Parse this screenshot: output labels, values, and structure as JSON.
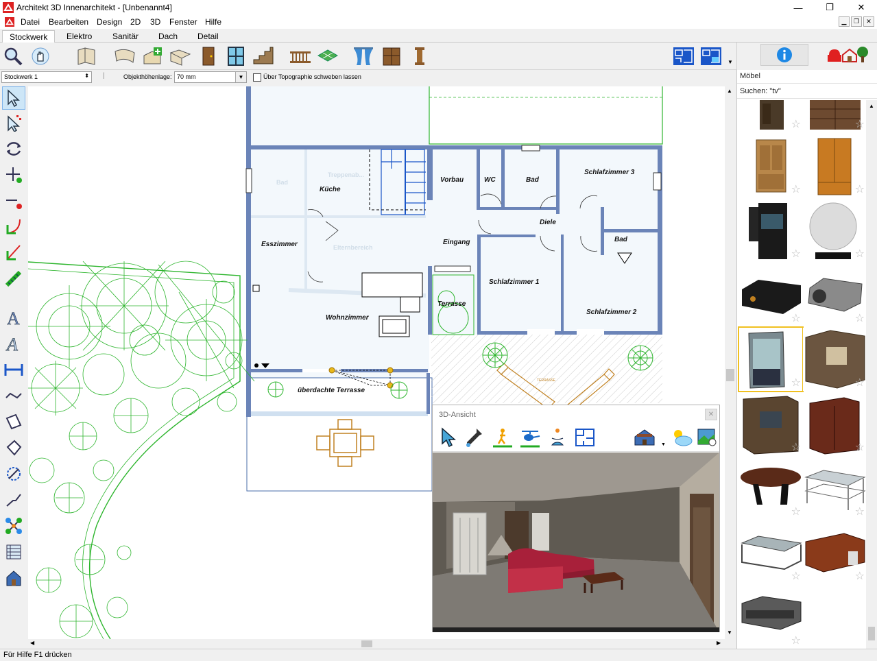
{
  "window": {
    "title": "Architekt 3D Innenarchitekt - [Unbenannt4]",
    "min": "—",
    "max": "❐",
    "close": "✕"
  },
  "menu": [
    "Datei",
    "Bearbeiten",
    "Design",
    "2D",
    "3D",
    "Fenster",
    "Hilfe"
  ],
  "tabs": [
    "Stockwerk",
    "Elektro",
    "Sanitär",
    "Dach",
    "Detail"
  ],
  "props": {
    "floor": "Stockwerk 1",
    "height_label": "Objekthöhenlage:",
    "height_value": "70 mm",
    "float_label": "Über Topographie schweben lassen"
  },
  "catalog": {
    "category": "Möbel",
    "search": "Suchen: \"tv\""
  },
  "rooms": {
    "kueche": "Küche",
    "esszimmer": "Esszimmer",
    "wohnzimmer": "Wohnzimmer",
    "vorbau": "Vorbau",
    "wc": "WC",
    "bad1": "Bad",
    "schlaf3": "Schlafzimmer 3",
    "diele": "Diele",
    "eingang": "Eingang",
    "bad2": "Bad",
    "schlaf1": "Schlafzimmer 1",
    "schlaf2": "Schlafzimmer 2",
    "terrasse": "Terrasse",
    "ueberdacht": "überdachte Terrasse",
    "bad_faint": "Bad",
    "treppe_faint": "Treppenab...",
    "eltern_faint": "Elternbereich",
    "terrasse_small": "TERRASSE"
  },
  "view3d": {
    "title": "3D-Ansicht"
  },
  "status": "Für Hilfe F1 drücken",
  "colors": {
    "wall": "#6b84b8",
    "plant": "#2db52d",
    "furniture": "#c08020",
    "select": "#f0c020"
  }
}
